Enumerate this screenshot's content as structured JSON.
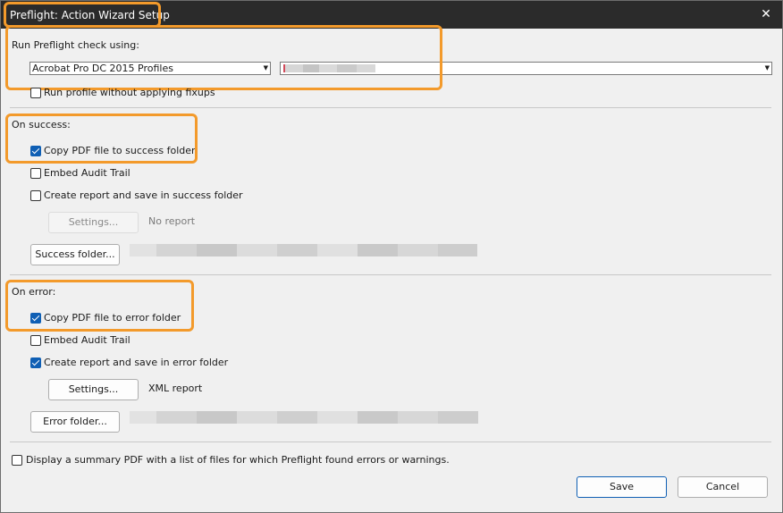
{
  "window": {
    "title": "Preflight: Action Wizard Setup",
    "close_icon": "close-icon"
  },
  "run_check": {
    "label": "Run Preflight check using:",
    "library_select": "Acrobat Pro DC 2015 Profiles",
    "profile_select": "",
    "no_fixups_label": "Run profile without applying fixups",
    "no_fixups_checked": false
  },
  "on_success": {
    "heading": "On success:",
    "copy_label": "Copy PDF file to success folder",
    "copy_checked": true,
    "audit_label": "Embed Audit Trail",
    "audit_checked": false,
    "report_label": "Create report and save in success folder",
    "report_checked": false,
    "settings_label": "Settings...",
    "report_status": "No report",
    "folder_button": "Success folder..."
  },
  "on_error": {
    "heading": "On error:",
    "copy_label": "Copy PDF file to error folder",
    "copy_checked": true,
    "audit_label": "Embed Audit Trail",
    "audit_checked": false,
    "report_label": "Create report and save in error folder",
    "report_checked": true,
    "settings_label": "Settings...",
    "report_status": "XML report",
    "folder_button": "Error folder..."
  },
  "summary": {
    "label": "Display a summary PDF with a list of files for which Preflight found errors or warnings.",
    "checked": false
  },
  "footer": {
    "save_label": "Save",
    "cancel_label": "Cancel"
  },
  "colors": {
    "highlight": "#f39a2b",
    "checkbox_checked": "#0f5fb4",
    "titlebar": "#2b2b2b"
  }
}
